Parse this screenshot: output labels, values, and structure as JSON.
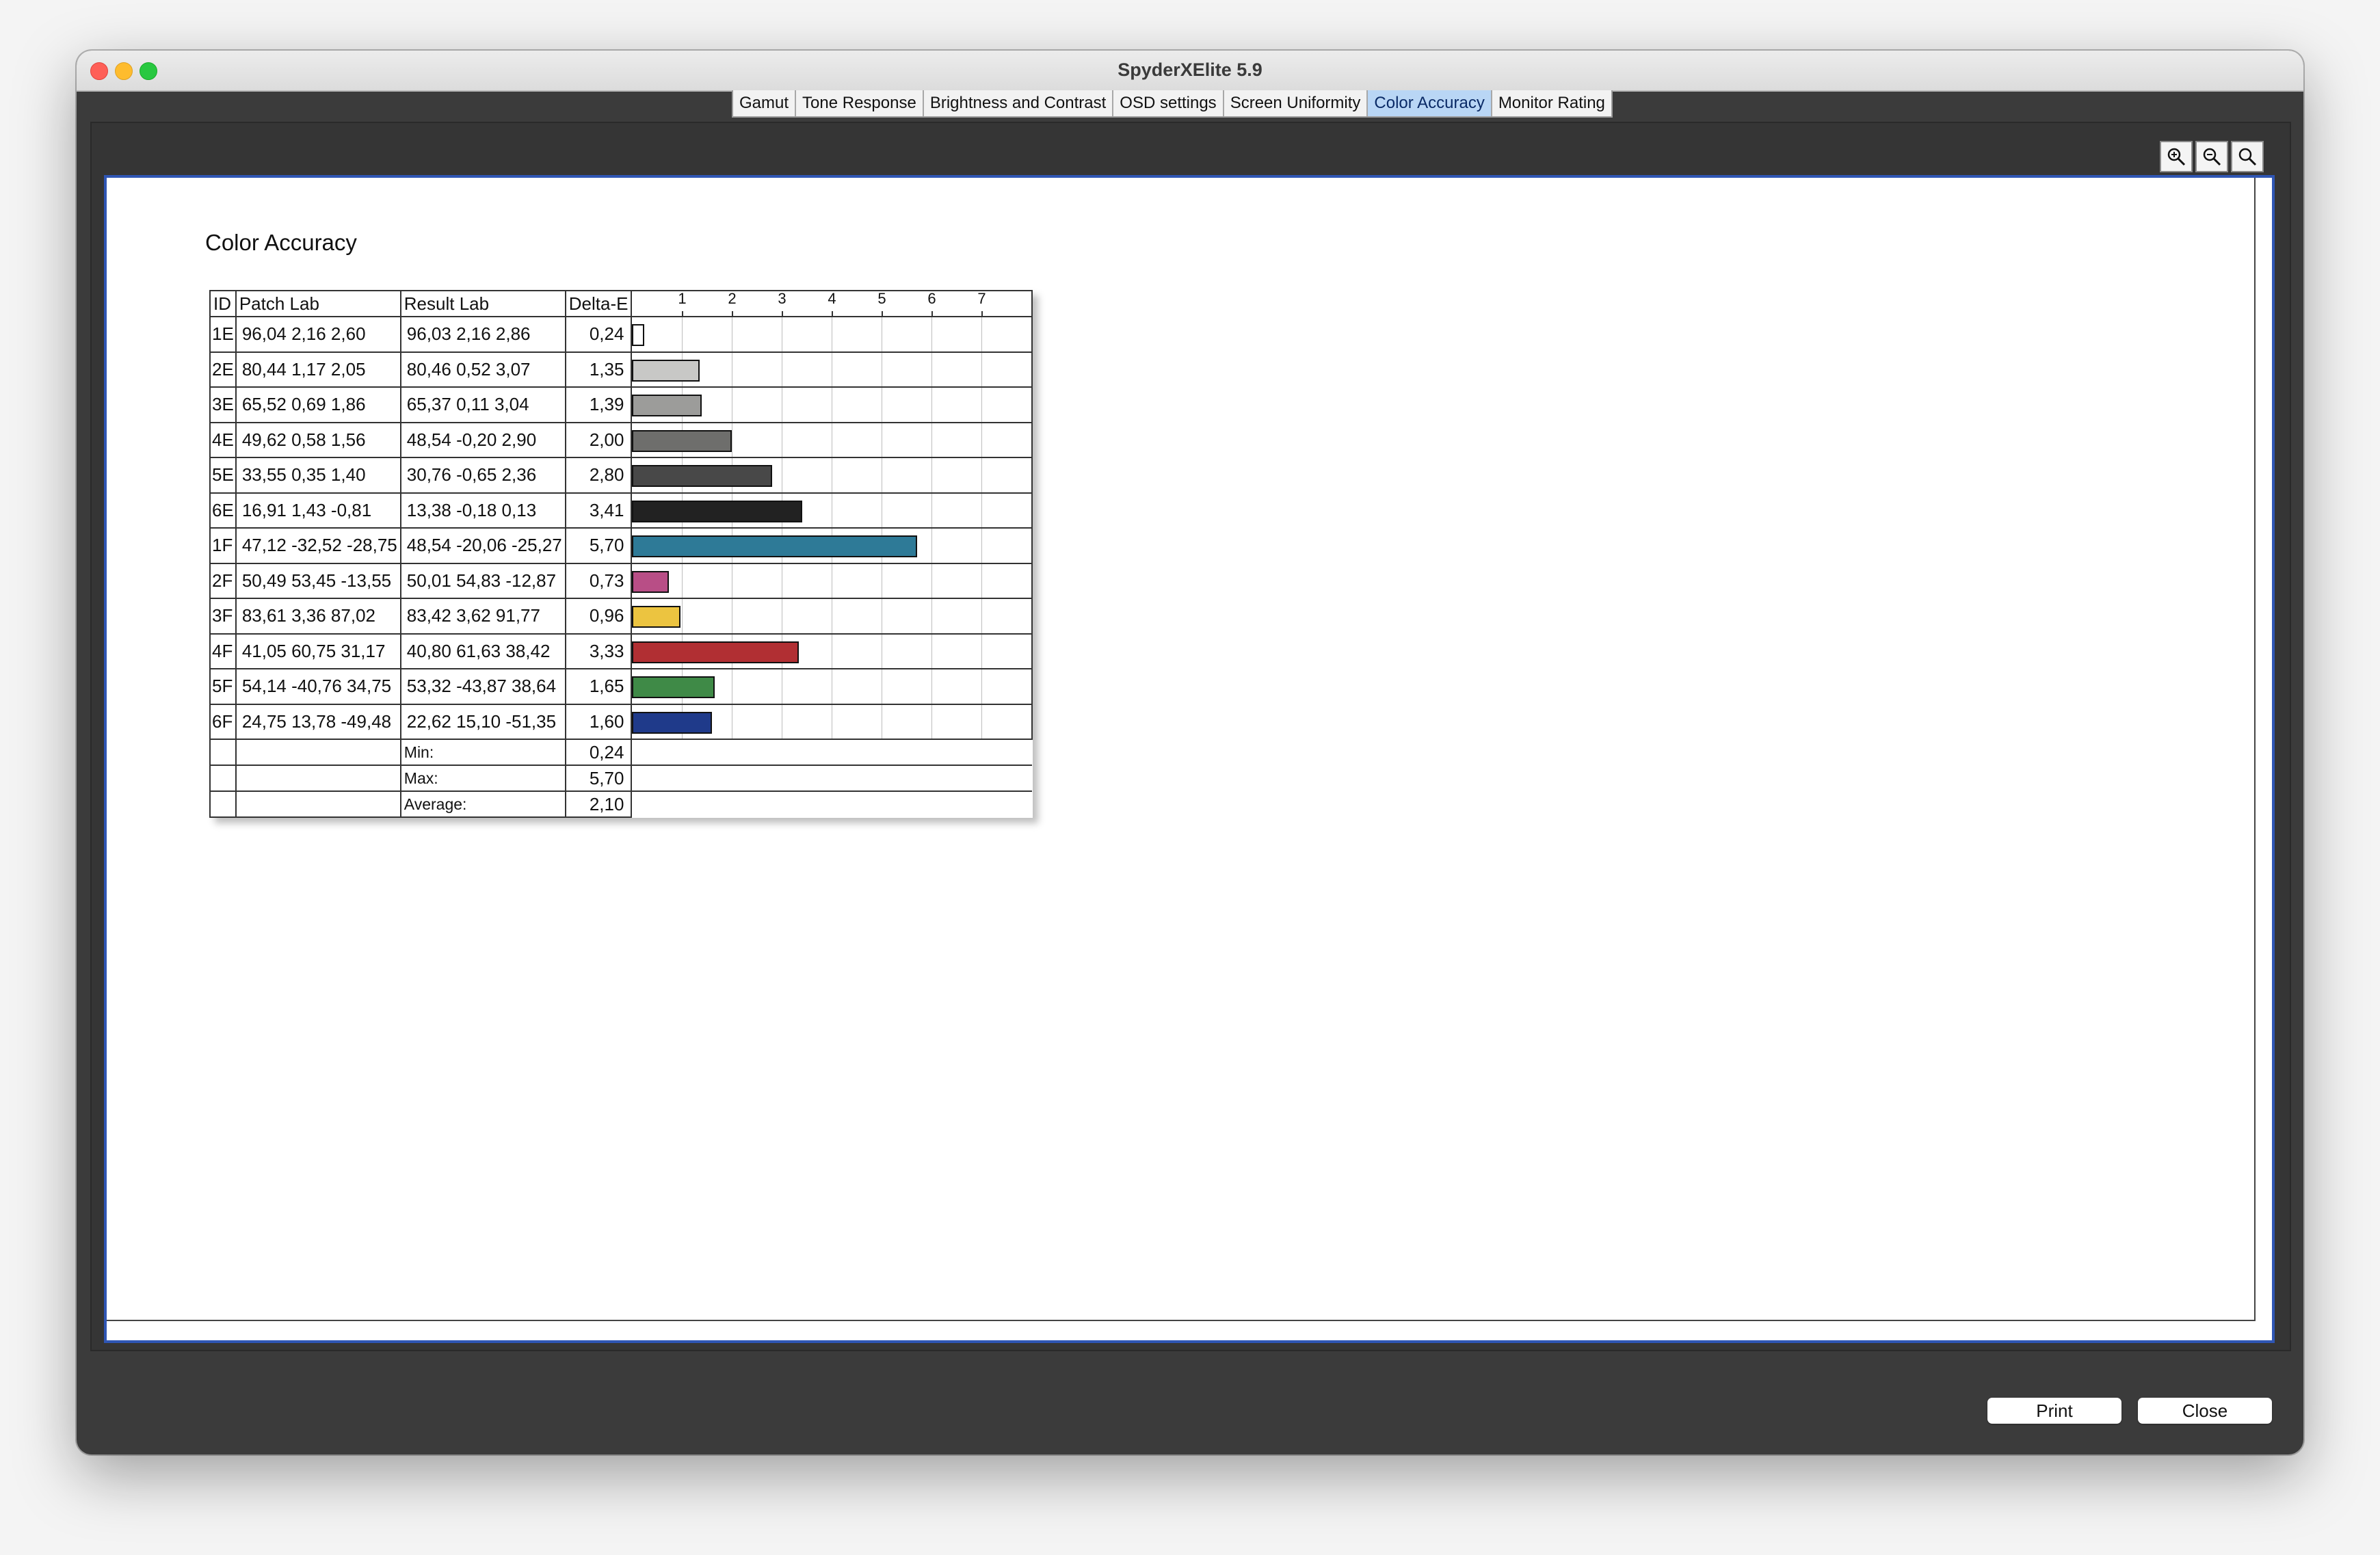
{
  "window": {
    "title": "SpyderXElite 5.9"
  },
  "tabs": [
    {
      "label": "Gamut"
    },
    {
      "label": "Tone Response"
    },
    {
      "label": "Brightness and Contrast"
    },
    {
      "label": "OSD settings"
    },
    {
      "label": "Screen Uniformity"
    },
    {
      "label": "Color Accuracy",
      "active": true
    },
    {
      "label": "Monitor Rating"
    }
  ],
  "zoom_tools": [
    "zoom-in-icon",
    "zoom-out-icon",
    "zoom-fit-icon"
  ],
  "report": {
    "title": "Color Accuracy",
    "headers": {
      "id": "ID",
      "patch": "Patch Lab",
      "result": "Result Lab",
      "delta": "Delta-E"
    },
    "axis_ticks": [
      "1",
      "2",
      "3",
      "4",
      "5",
      "6",
      "7"
    ],
    "rows": [
      {
        "id": "1E",
        "patch": "96,04  2,16  2,60",
        "result": "96,03  2,16  2,86",
        "delta": "0,24",
        "value": 0.24,
        "color": "#ffffff"
      },
      {
        "id": "2E",
        "patch": "80,44  1,17  2,05",
        "result": "80,46  0,52  3,07",
        "delta": "1,35",
        "value": 1.35,
        "color": "#c8c8c6"
      },
      {
        "id": "3E",
        "patch": "65,52  0,69  1,86",
        "result": "65,37  0,11  3,04",
        "delta": "1,39",
        "value": 1.39,
        "color": "#9c9c9a"
      },
      {
        "id": "4E",
        "patch": "49,62  0,58  1,56",
        "result": "48,54  -0,20  2,90",
        "delta": "2,00",
        "value": 2.0,
        "color": "#6e6e6c"
      },
      {
        "id": "5E",
        "patch": "33,55  0,35  1,40",
        "result": "30,76  -0,65  2,36",
        "delta": "2,80",
        "value": 2.8,
        "color": "#484848"
      },
      {
        "id": "6E",
        "patch": "16,91  1,43  -0,81",
        "result": "13,38  -0,18  0,13",
        "delta": "3,41",
        "value": 3.41,
        "color": "#222222"
      },
      {
        "id": "1F",
        "patch": "47,12 -32,52 -28,75",
        "result": "48,54 -20,06 -25,27",
        "delta": "5,70",
        "value": 5.7,
        "color": "#2e7a97"
      },
      {
        "id": "2F",
        "patch": "50,49  53,45 -13,55",
        "result": "50,01  54,83 -12,87",
        "delta": "0,73",
        "value": 0.73,
        "color": "#b84e86"
      },
      {
        "id": "3F",
        "patch": "83,61  3,36  87,02",
        "result": "83,42  3,62  91,77",
        "delta": "0,96",
        "value": 0.96,
        "color": "#ecc440"
      },
      {
        "id": "4F",
        "patch": "41,05  60,75  31,17",
        "result": "40,80  61,63  38,42",
        "delta": "3,33",
        "value": 3.33,
        "color": "#b12f33"
      },
      {
        "id": "5F",
        "patch": "54,14 -40,76  34,75",
        "result": "53,32 -43,87  38,64",
        "delta": "1,65",
        "value": 1.65,
        "color": "#3f8a47"
      },
      {
        "id": "6F",
        "patch": "24,75  13,78 -49,48",
        "result": "22,62  15,10 -51,35",
        "delta": "1,60",
        "value": 1.6,
        "color": "#1f3a8a"
      }
    ],
    "summary": [
      {
        "label": "Min:",
        "value": "0,24"
      },
      {
        "label": "Max:",
        "value": "5,70"
      },
      {
        "label": "Average:",
        "value": "2,10"
      }
    ]
  },
  "chart_data": {
    "type": "bar",
    "orientation": "horizontal",
    "categories": [
      "1E",
      "2E",
      "3E",
      "4E",
      "5E",
      "6E",
      "1F",
      "2F",
      "3F",
      "4F",
      "5F",
      "6F"
    ],
    "values": [
      0.24,
      1.35,
      1.39,
      2.0,
      2.8,
      3.41,
      5.7,
      0.73,
      0.96,
      3.33,
      1.65,
      1.6
    ],
    "xlim": [
      0,
      8
    ],
    "grid": true
  },
  "footer": {
    "print_label": "Print",
    "close_label": "Close"
  }
}
